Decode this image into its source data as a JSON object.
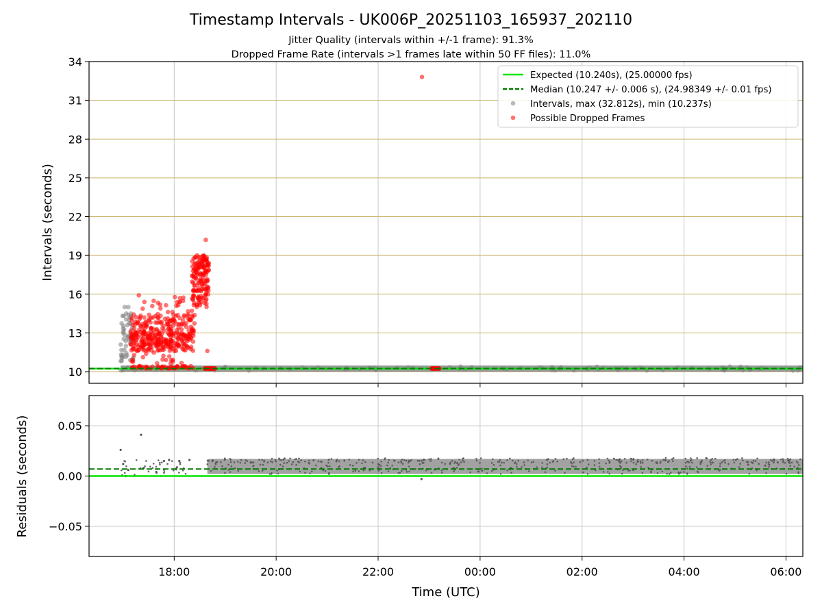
{
  "chart_data": [
    {
      "type": "scatter",
      "title": "Timestamp Intervals - UK006P_20251103_165937_202110",
      "subtitle_lines": [
        "Jitter Quality (intervals within +/-1 frame): 91.3%",
        "Dropped Frame Rate (intervals >1 frames late within 50 FF files): 11.0%"
      ],
      "xlabel": "",
      "ylabel": "Intervals (seconds)",
      "ylim": [
        9.1,
        34
      ],
      "xlim_hours": [
        16.33,
        30.33
      ],
      "yticks": [
        10,
        13,
        16,
        19,
        22,
        25,
        28,
        31,
        34
      ],
      "ytick_labels": [
        "10",
        "13",
        "16",
        "19",
        "22",
        "25",
        "28",
        "31",
        "34"
      ],
      "grid": true,
      "horizontal_gridline_color": "#c9b46a",
      "legend_position": "top-right",
      "legend": [
        "Expected (10.240s), (25.00000 fps)",
        "Median (10.247 +/- 0.006 s), (24.98349 +/- 0.01 fps)",
        "Intervals, max (32.812s), min (10.237s)",
        "Possible Dropped Frames"
      ],
      "lines": [
        {
          "name": "Expected",
          "y": 10.24,
          "color": "#00e600",
          "style": "solid"
        },
        {
          "name": "Median",
          "y": 10.247,
          "color": "#007a00",
          "style": "dashed"
        }
      ],
      "series": [
        {
          "name": "Intervals",
          "color": "#808080",
          "x_range_hours": [
            16.95,
            30.33
          ],
          "baseline": 10.24,
          "scattered_points": [
            [
              16.95,
              12.1
            ],
            [
              16.97,
              11.1
            ],
            [
              17.0,
              13.0
            ],
            [
              17.03,
              15.0
            ],
            [
              17.06,
              14.5
            ],
            [
              17.1,
              15.0
            ],
            [
              17.08,
              13.6
            ],
            [
              17.12,
              14.0
            ],
            [
              17.15,
              12.4
            ]
          ]
        },
        {
          "name": "Possible Dropped Frames",
          "color": "#ff0000",
          "cluster_range_hours": [
            17.15,
            18.4
          ],
          "upper_cluster_range_hours": [
            18.35,
            18.68
          ],
          "points": [
            [
              18.7,
              10.24
            ],
            [
              18.8,
              10.24
            ],
            [
              18.65,
              11.6
            ],
            [
              18.62,
              20.2
            ],
            [
              18.58,
              19.0
            ],
            [
              18.45,
              19.0
            ],
            [
              23.05,
              10.24
            ],
            [
              23.2,
              10.24
            ],
            [
              22.86,
              32.81
            ]
          ]
        }
      ]
    },
    {
      "type": "scatter",
      "title": "",
      "xlabel": "Time (UTC)",
      "ylabel": "Residuals (seconds)",
      "ylim": [
        -0.08,
        0.08
      ],
      "yticks": [
        0.05,
        0.0,
        -0.05
      ],
      "ytick_labels": [
        "0.05",
        "0.00",
        "−0.05"
      ],
      "xticks_hours": [
        18,
        20,
        22,
        24,
        26,
        28,
        30
      ],
      "xtick_labels": [
        "18:00",
        "20:00",
        "22:00",
        "00:00",
        "02:00",
        "04:00",
        "06:00"
      ],
      "grid": true,
      "lines": [
        {
          "name": "Expected",
          "y": 0.0,
          "color": "#00e600",
          "style": "solid"
        },
        {
          "name": "Median",
          "y": 0.007,
          "color": "#007a00",
          "style": "dashed"
        }
      ],
      "series": [
        {
          "name": "Residuals",
          "color": "#555555",
          "dense_band_hours": [
            18.65,
            30.33
          ],
          "band_values": [
            0.002,
            0.017
          ],
          "points": [
            [
              16.95,
              0.026
            ],
            [
              17.35,
              0.041
            ],
            [
              17.0,
              0.012
            ],
            [
              17.05,
              0.0
            ],
            [
              17.1,
              0.006
            ],
            [
              17.4,
              0.008
            ],
            [
              17.65,
              0.004
            ],
            [
              17.8,
              0.015
            ],
            [
              17.9,
              0.016
            ],
            [
              18.1,
              0.015
            ],
            [
              18.3,
              0.016
            ],
            [
              22.85,
              -0.003
            ]
          ]
        }
      ]
    }
  ]
}
